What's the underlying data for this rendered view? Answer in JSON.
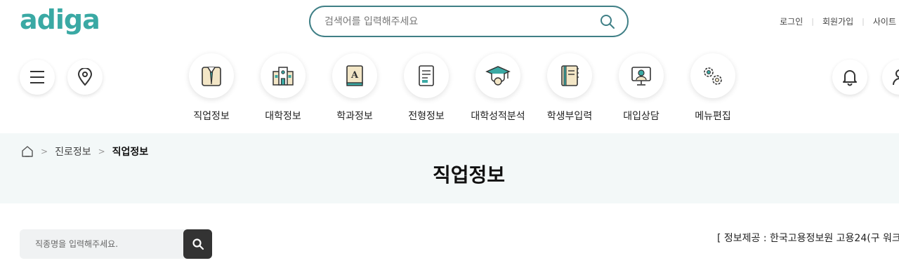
{
  "header": {
    "logo_text": "adiga",
    "search_placeholder": "검색어를 입력해주세요",
    "util_links": [
      "로그인",
      "회원가입",
      "사이트"
    ]
  },
  "menu": [
    {
      "label": "직업정보",
      "icon": "job-info-icon"
    },
    {
      "label": "대학정보",
      "icon": "university-icon"
    },
    {
      "label": "학과정보",
      "icon": "department-book-icon"
    },
    {
      "label": "전형정보",
      "icon": "admission-document-icon"
    },
    {
      "label": "대학성적분석",
      "icon": "graduation-cap-icon"
    },
    {
      "label": "학생부입력",
      "icon": "notebook-icon"
    },
    {
      "label": "대입상담",
      "icon": "consult-monitor-icon"
    },
    {
      "label": "메뉴편집",
      "icon": "gear-icon"
    }
  ],
  "breadcrumb": {
    "home_icon": "home-icon",
    "items": [
      "진로정보",
      "직업정보"
    ]
  },
  "page_title": "직업정보",
  "job_search": {
    "placeholder": "직종명을 입력해주세요.",
    "button_icon": "search-icon"
  },
  "source_text": "[ 정보제공 : 한국고용정보원 고용24(구 워크",
  "colors": {
    "brand": "#3aa9a4",
    "search_border": "#3f7f86",
    "band_bg": "#f3f8f8",
    "button_dark": "#333333"
  }
}
